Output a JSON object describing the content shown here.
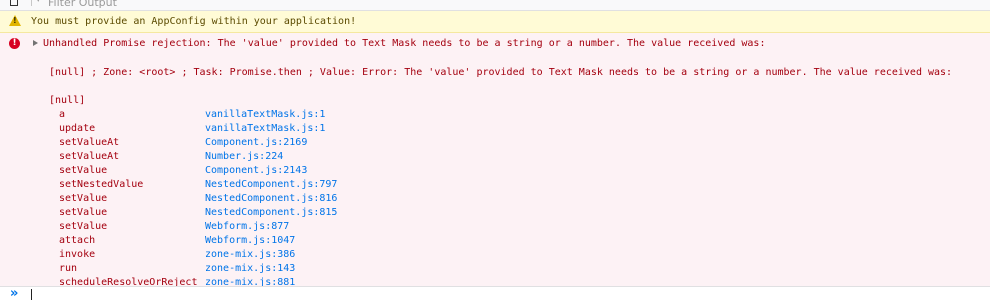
{
  "toolbar": {
    "filter_placeholder": "Filter Output",
    "filter_icon": "filter-icon",
    "clear_icon": "trash-icon"
  },
  "warning": {
    "icon": "warning-icon",
    "icon_glyph": "!",
    "text": "You must provide an AppConfig within your application!"
  },
  "error": {
    "icon": "error-icon",
    "icon_glyph": "!",
    "line1": "Unhandled Promise rejection: The 'value' provided to Text Mask needs to be a string or a number. The value received was:",
    "line2": "[null] ; Zone: <root> ; Task: Promise.then ; Value: Error: The 'value' provided to Text Mask needs to be a string or a number. The value received was:",
    "line3": "[null]",
    "stack": [
      {
        "fn": "a",
        "loc": "vanillaTextMask.js:1"
      },
      {
        "fn": "update",
        "loc": "vanillaTextMask.js:1"
      },
      {
        "fn": "setValueAt",
        "loc": "Component.js:2169"
      },
      {
        "fn": "setValueAt",
        "loc": "Number.js:224"
      },
      {
        "fn": "setValue",
        "loc": "Component.js:2143"
      },
      {
        "fn": "setNestedValue",
        "loc": "NestedComponent.js:797"
      },
      {
        "fn": "setValue",
        "loc": "NestedComponent.js:816"
      },
      {
        "fn": "setValue",
        "loc": "NestedComponent.js:815"
      },
      {
        "fn": "setValue",
        "loc": "Webform.js:877"
      },
      {
        "fn": "attach",
        "loc": "Webform.js:1047"
      },
      {
        "fn": "invoke",
        "loc": "zone-mix.js:386"
      },
      {
        "fn": "run",
        "loc": "zone-mix.js:143"
      },
      {
        "fn": "scheduleResolveOrReject",
        "loc": "zone-mix.js:881"
      }
    ]
  },
  "console_input": {
    "prompt": "»",
    "value": ""
  },
  "colors": {
    "warning_bg": "#fffbd6",
    "warning_text": "#5b4a00",
    "error_bg": "#fdf2f5",
    "error_text": "#a4000f",
    "link": "#0074e8"
  }
}
